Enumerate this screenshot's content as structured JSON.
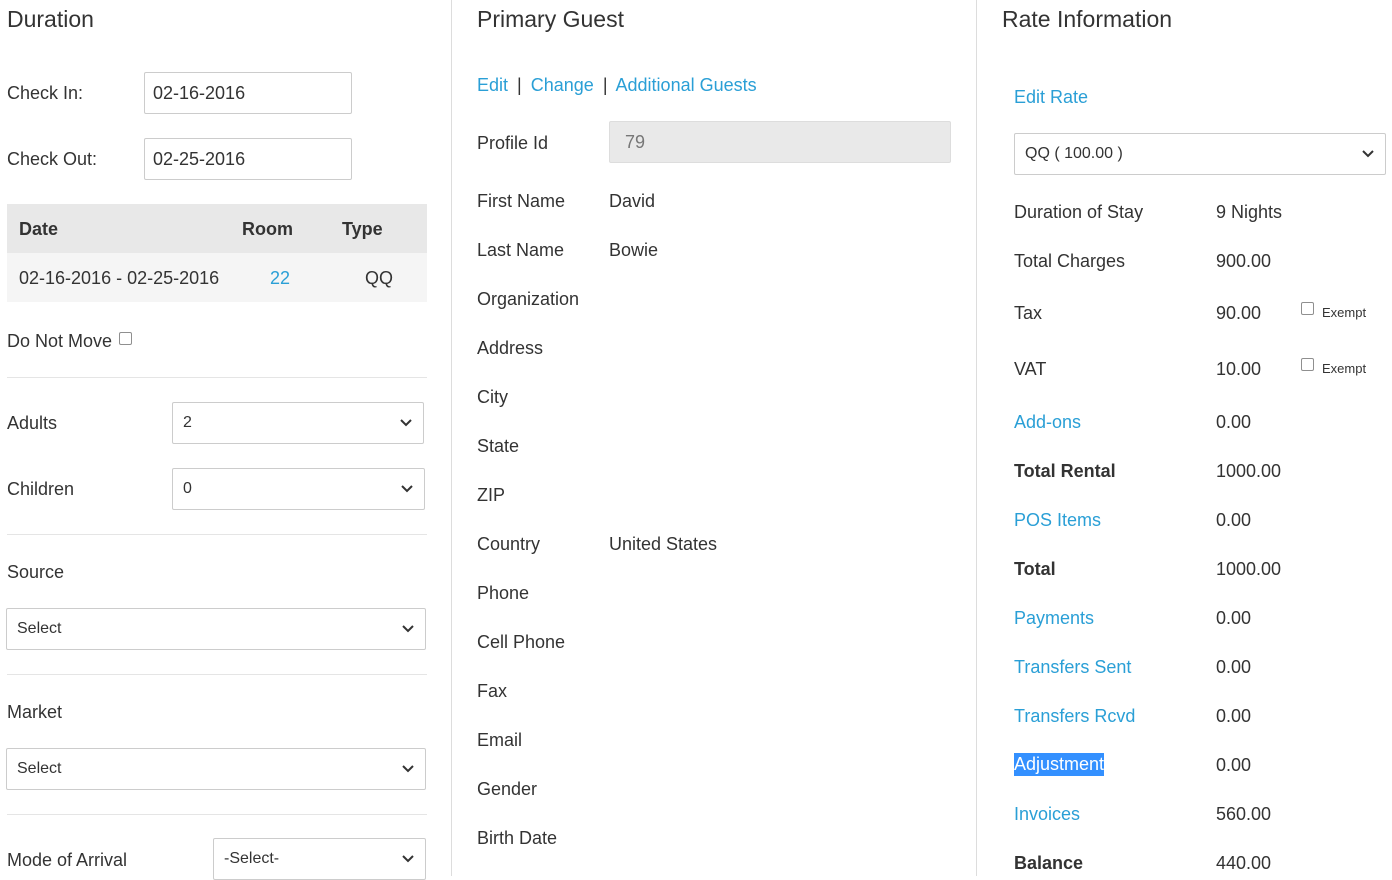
{
  "duration": {
    "title": "Duration",
    "check_in_label": "Check In:",
    "check_in_value": "02-16-2016",
    "check_out_label": "Check Out:",
    "check_out_value": "02-25-2016",
    "table": {
      "headers": {
        "date": "Date",
        "room": "Room",
        "type": "Type"
      },
      "row": {
        "date": "02-16-2016 - 02-25-2016",
        "room": "22",
        "type": "QQ"
      }
    },
    "do_not_move_label": "Do Not Move",
    "do_not_move_checked": false,
    "adults_label": "Adults",
    "adults_value": "2",
    "children_label": "Children",
    "children_value": "0",
    "source_label": "Source",
    "source_value": "Select",
    "market_label": "Market",
    "market_value": "Select",
    "mode_of_arrival_label": "Mode of Arrival",
    "mode_of_arrival_value": "-Select-"
  },
  "guest": {
    "title": "Primary Guest",
    "links": {
      "edit": "Edit",
      "sep1": "|",
      "change": "Change",
      "sep2": "|",
      "additional": "Additional Guests"
    },
    "profile_id_label": "Profile Id",
    "profile_id_value": "79",
    "fields": [
      {
        "label": "First Name",
        "value": "David"
      },
      {
        "label": "Last Name",
        "value": "Bowie"
      },
      {
        "label": "Organization",
        "value": ""
      },
      {
        "label": "Address",
        "value": ""
      },
      {
        "label": "City",
        "value": ""
      },
      {
        "label": "State",
        "value": ""
      },
      {
        "label": "ZIP",
        "value": ""
      },
      {
        "label": "Country",
        "value": "United States"
      },
      {
        "label": "Phone",
        "value": ""
      },
      {
        "label": "Cell Phone",
        "value": ""
      },
      {
        "label": "Fax",
        "value": ""
      },
      {
        "label": "Email",
        "value": ""
      },
      {
        "label": "Gender",
        "value": ""
      },
      {
        "label": "Birth Date",
        "value": ""
      }
    ]
  },
  "rate": {
    "title": "Rate Information",
    "edit_rate": "Edit Rate",
    "rate_select_value": "QQ ( 100.00 )",
    "exempt_label": "Exempt",
    "rows": [
      {
        "label": "Duration of Stay",
        "value": "9 Nights"
      },
      {
        "label": "Total Charges",
        "value": "900.00"
      },
      {
        "label": "Tax",
        "value": "90.00"
      },
      {
        "label": "VAT",
        "value": "10.00"
      },
      {
        "label": "Add-ons",
        "value": "0.00"
      },
      {
        "label": "Total Rental",
        "value": "1000.00"
      },
      {
        "label": "POS Items",
        "value": "0.00"
      },
      {
        "label": "Total",
        "value": "1000.00"
      },
      {
        "label": "Payments",
        "value": "0.00"
      },
      {
        "label": "Transfers Sent",
        "value": "0.00"
      },
      {
        "label": "Transfers Rcvd",
        "value": "0.00"
      },
      {
        "label": "Adjustment",
        "value": "0.00"
      },
      {
        "label": "Invoices",
        "value": "560.00"
      },
      {
        "label": "Balance",
        "value": "440.00"
      }
    ]
  },
  "colors": {
    "link": "#2a9fd6",
    "selection": "#3390ff",
    "table_header": "#e8e8e8"
  }
}
